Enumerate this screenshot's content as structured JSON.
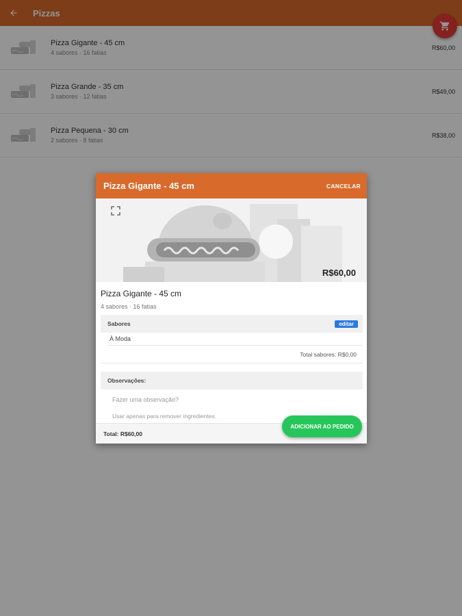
{
  "appbar": {
    "title": "Pizzas"
  },
  "products": [
    {
      "name": "Pizza Gigante - 45 cm",
      "description": "4 sabores · 16 fatias",
      "price": "R$60,00"
    },
    {
      "name": "Pizza Grande - 35 cm",
      "description": "3 sabores · 12 fatias",
      "price": "R$49,00"
    },
    {
      "name": "Pizza Pequena - 30 cm",
      "description": "2 sabores · 8 fatias",
      "price": "R$38,00"
    }
  ],
  "dialog": {
    "title": "Pizza Gigante - 45 cm",
    "cancel_label": "CANCELAR",
    "banner_price": "R$60,00",
    "product_name": "Pizza Gigante - 45 cm",
    "product_desc": "4 sabores · 16 fatias",
    "flavors_title": "Sabores",
    "edit_label": "editar",
    "flavor_item": "À Moda",
    "flavors_total": "Total sabores: R$0,00",
    "notes_title": "Observações:",
    "notes_placeholder": "Fazer uma observação?",
    "notes_hint": "Usar apenas para remover ingredientes.",
    "total": "Total: R$60,00",
    "add_button": "ADICIONAR AO PEDIDO"
  },
  "colors": {
    "primary": "#d86a2c",
    "fab": "#e53935",
    "success": "#27c65a",
    "edit": "#2b79e0"
  },
  "icons": {
    "back": "arrow-back-icon",
    "cart": "cart-icon",
    "expand": "expand-icon",
    "thumbnail": "pizza-placeholder-icon"
  }
}
